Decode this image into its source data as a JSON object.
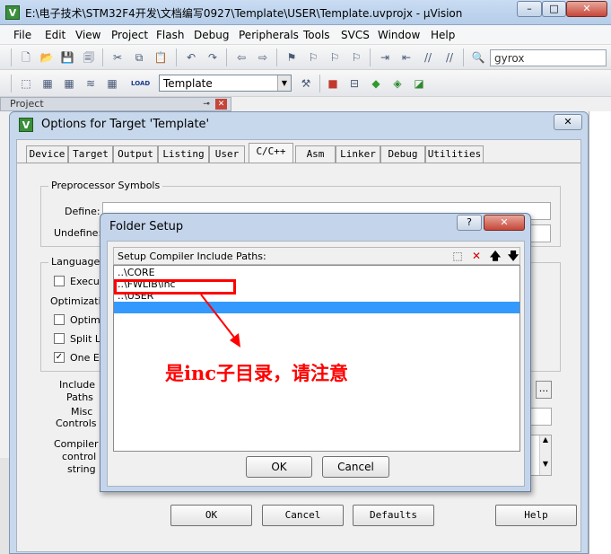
{
  "window": {
    "title": "E:\\电子技术\\STM32F4开发\\文档编写0927\\Template\\USER\\Template.uvprojx - µVision",
    "icon_label": "V",
    "caption_min": "–",
    "caption_max": "□",
    "caption_close": "✕"
  },
  "menu": [
    "File",
    "Edit",
    "View",
    "Project",
    "Flash",
    "Debug",
    "Peripherals",
    "Tools",
    "SVCS",
    "Window",
    "Help"
  ],
  "toolbar": {
    "find_value": "gyrox",
    "target_value": "Template",
    "target_dropdown": "▼",
    "load_label": "LOAD"
  },
  "project_panel": {
    "title": "Project",
    "pin": "📌",
    "close": "✕"
  },
  "options_dialog": {
    "title": "Options for Target 'Template'",
    "close": "✕",
    "tabs": [
      "Device",
      "Target",
      "Output",
      "Listing",
      "User",
      "C/C++",
      "Asm",
      "Linker",
      "Debug",
      "Utilities"
    ],
    "preprocessor": {
      "group": "Preprocessor Symbols",
      "define": "Define:",
      "undefine": "Undefine:"
    },
    "language": {
      "group": "Language /",
      "execute": "Execute",
      "optimization": "Optimization",
      "optimize": "Optimize",
      "split_load": "Split Loa",
      "one_elf": "One ELF",
      "one_elf_mark": "✓"
    },
    "include_paths": "Include\nPaths",
    "include_line1": "Include",
    "include_line2": "Paths",
    "misc_line1": "Misc",
    "misc_line2": "Controls",
    "compiler_line1": "Compiler",
    "compiler_line2": "control",
    "compiler_line3": "string",
    "browse": "...",
    "buttons": {
      "ok": "OK",
      "cancel": "Cancel",
      "defaults": "Defaults",
      "help": "Help"
    }
  },
  "folder_setup": {
    "title": "Folder Setup",
    "help": "?",
    "close": "✕",
    "header": "Setup Compiler Include Paths:",
    "paths": [
      "..\\CORE",
      "..\\FWLIB\\inc",
      "..\\USER"
    ],
    "ok": "OK",
    "cancel": "Cancel"
  },
  "annotation": {
    "text": "是inc子目录，请注意",
    "color": "#ff0000"
  },
  "colors": {
    "selection": "#3399ff",
    "title_bar": "#c9dcf2",
    "dialog_frame": "#c4d5eb"
  }
}
